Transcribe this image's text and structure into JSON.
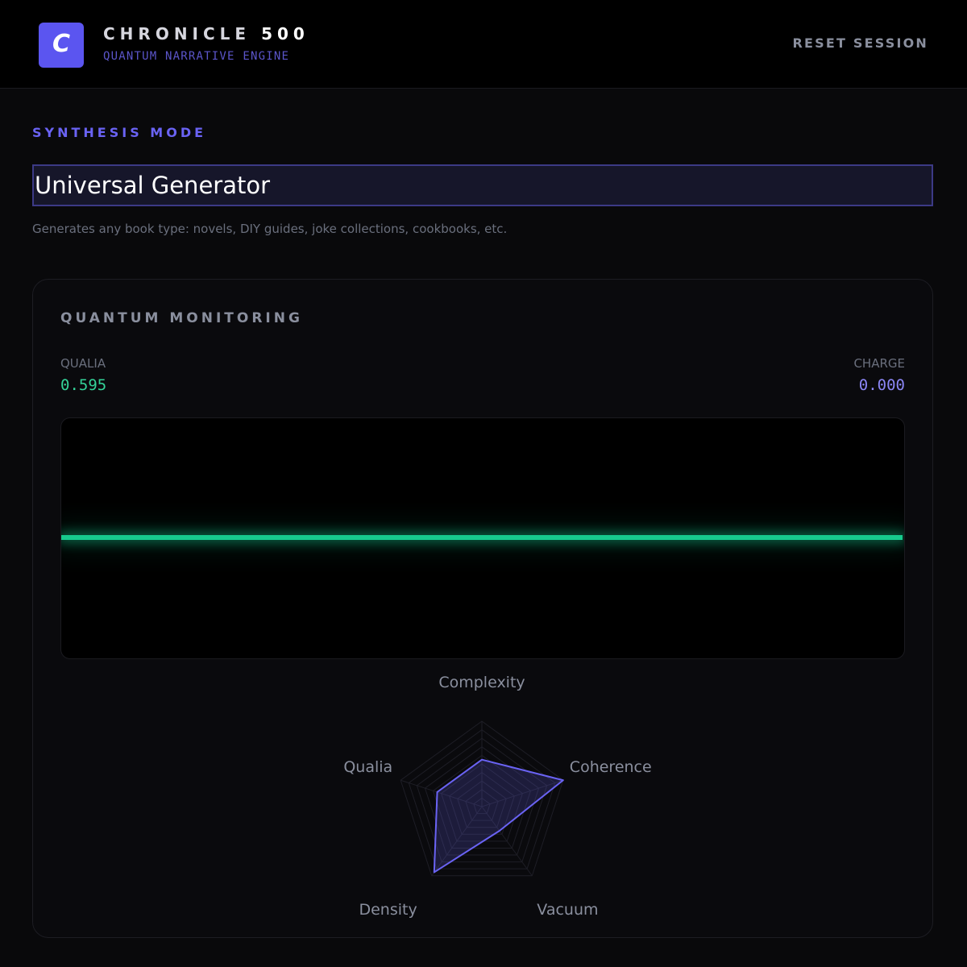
{
  "header": {
    "logo_letter": "C",
    "title_word": "CHRONICLE",
    "title_number": "500",
    "subtitle": "QUANTUM NARRATIVE ENGINE",
    "reset_label": "RESET SESSION"
  },
  "synthesis": {
    "label": "SYNTHESIS MODE",
    "selected": "Universal Generator",
    "description": "Generates any book type: novels, DIY guides, joke collections, cookbooks, etc."
  },
  "monitoring": {
    "title": "QUANTUM MONITORING",
    "qualia_label": "QUALIA",
    "qualia_value": "0.595",
    "charge_label": "CHARGE",
    "charge_value": "0.000"
  },
  "chart_data": {
    "type": "radar",
    "axes": [
      "Complexity",
      "Coherence",
      "Vacuum",
      "Density",
      "Qualia"
    ],
    "values": [
      0.55,
      1.0,
      0.35,
      0.95,
      0.55
    ],
    "range": [
      0,
      1
    ],
    "colors": {
      "series": "#6a63f4",
      "grid": "#1e1e26"
    }
  }
}
